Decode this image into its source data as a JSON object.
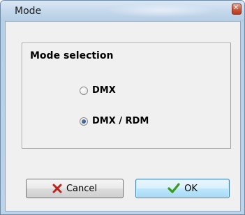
{
  "window": {
    "title": "Mode"
  },
  "group": {
    "title": "Mode selection",
    "options": [
      {
        "label": "DMX",
        "selected": false
      },
      {
        "label": "DMX / RDM",
        "selected": true
      }
    ]
  },
  "buttons": {
    "cancel": {
      "label": "Cancel",
      "icon": "red-x-icon"
    },
    "ok": {
      "label": "OK",
      "icon": "green-check-icon"
    }
  },
  "colors": {
    "titlebar": "#c3d8ec",
    "client_bg": "#f0f0f0",
    "cancel_icon": "#c0211b",
    "ok_icon": "#3a9a1e",
    "radio_selected": "#1c3f79"
  }
}
